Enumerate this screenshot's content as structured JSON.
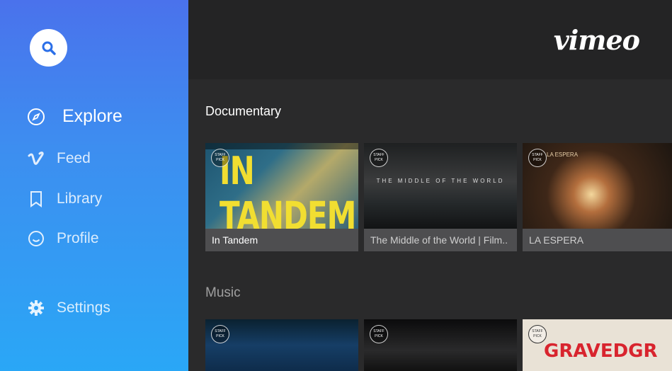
{
  "sidebar": {
    "search_icon": "search-icon",
    "items": [
      {
        "label": "Explore",
        "icon": "compass-icon"
      },
      {
        "label": "Feed",
        "icon": "vimeo-v-icon"
      },
      {
        "label": "Library",
        "icon": "bookmark-icon"
      },
      {
        "label": "Profile",
        "icon": "smiley-icon"
      },
      {
        "label": "Settings",
        "icon": "gear-icon"
      }
    ]
  },
  "header": {
    "logo": "vimeo"
  },
  "sections": [
    {
      "title": "Documentary",
      "cards": [
        {
          "title": "In Tandem",
          "thumb_text": "IN TANDEM",
          "badge": "STAFF PICK"
        },
        {
          "title": "The Middle of the World | Film..",
          "thumb_text": "THE MIDDLE OF THE WORLD",
          "badge": "STAFF PICK"
        },
        {
          "title": "LA ESPERA",
          "thumb_text": "LA ESPERA",
          "badge": "STAFF PICK"
        }
      ]
    },
    {
      "title": "Music",
      "cards": [
        {
          "badge": "STAFF PICK"
        },
        {
          "badge": "STAFF PICK"
        },
        {
          "thumb_text": "GRAVEDGR",
          "badge": "STAFF PICK"
        }
      ]
    }
  ],
  "colors": {
    "sidebar_top": "#4a72ec",
    "sidebar_bottom": "#2aa7f6",
    "background": "#2a2a2b",
    "caption_bg": "#4e4e50"
  }
}
